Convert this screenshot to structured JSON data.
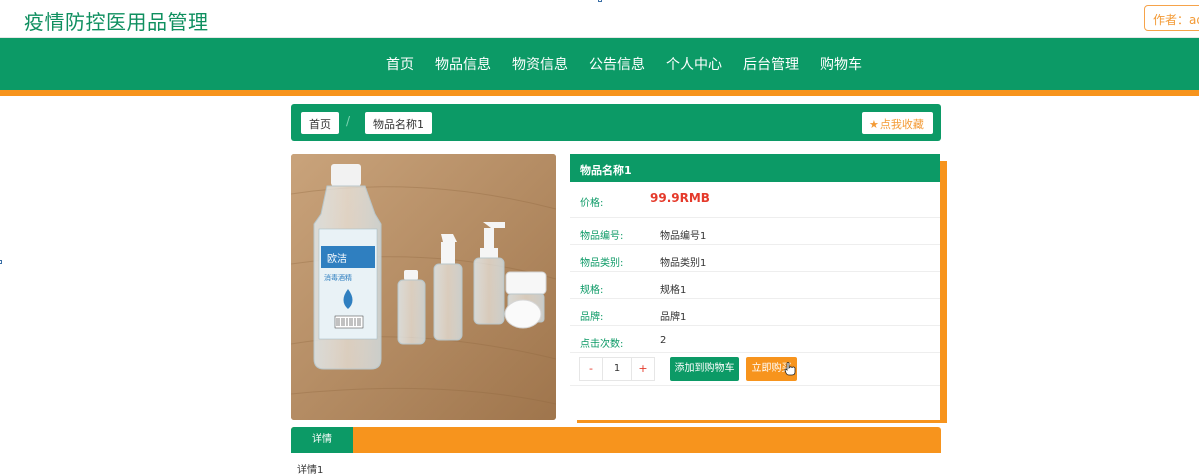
{
  "header": {
    "site_title": "疫情防控医用品管理",
    "author_label": "作者：admin"
  },
  "nav": {
    "items": [
      "首页",
      "物品信息",
      "物资信息",
      "公告信息",
      "个人中心",
      "后台管理",
      "购物车"
    ]
  },
  "breadcrumb": {
    "home": "首页",
    "separator": "/",
    "current": "物品名称1",
    "favorite_label": "点我收藏"
  },
  "product": {
    "name": "物品名称1",
    "price_label": "价格:",
    "price": "99.9RMB",
    "fields": [
      {
        "label": "物品编号:",
        "value": "物品编号1"
      },
      {
        "label": "物品类别:",
        "value": "物品类别1"
      },
      {
        "label": "规格:",
        "value": "规格1"
      },
      {
        "label": "品牌:",
        "value": "品牌1"
      },
      {
        "label": "点击次数:",
        "value": "2"
      }
    ],
    "quantity": "1",
    "minus_label": "-",
    "plus_label": "+",
    "add_cart_label": "添加到购物车",
    "buy_now_label": "立即购买",
    "image_text": {
      "brand": "欧洁",
      "type": "消毒酒精"
    }
  },
  "detail": {
    "tab_label": "详情",
    "content": "详情1"
  },
  "colors": {
    "primary": "#0c9a66",
    "accent": "#f7941d",
    "price": "#e53a2b"
  }
}
